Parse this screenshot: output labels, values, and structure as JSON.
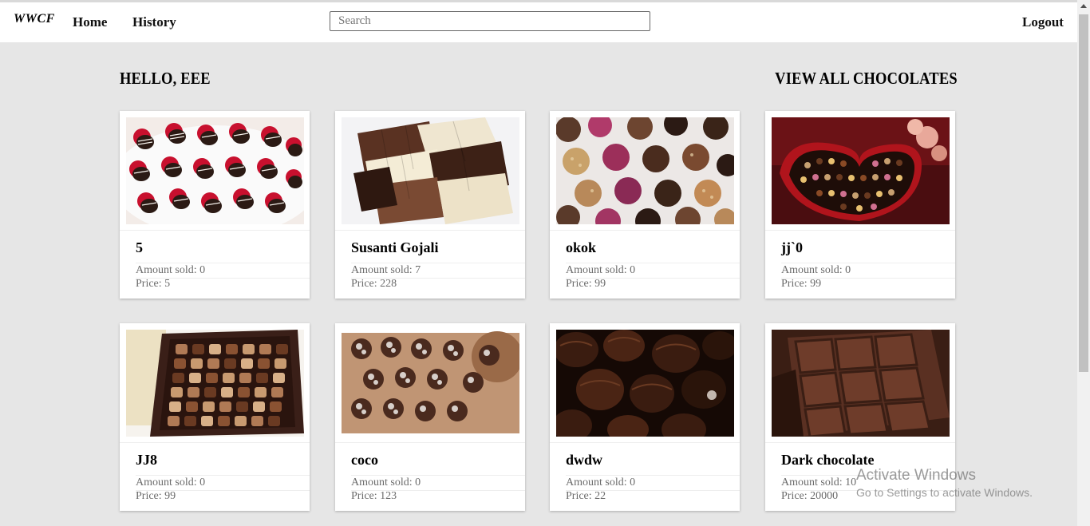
{
  "nav": {
    "brand": "WWCF",
    "home": "Home",
    "history": "History",
    "search_placeholder": "Search",
    "logout": "Logout"
  },
  "main": {
    "greeting": "HELLO, EEE",
    "view_all": "VIEW ALL CHOCOLATES"
  },
  "cards": [
    {
      "name": "5",
      "sold": "Amount sold: 0",
      "price": "Price: 5",
      "image": "chocolate-strawberries"
    },
    {
      "name": "Susanti Gojali",
      "sold": "Amount sold: 7",
      "price": "Price: 228",
      "image": "chocolate-bar-stack"
    },
    {
      "name": "okok",
      "sold": "Amount sold: 0",
      "price": "Price: 99",
      "image": "truffles-assorted"
    },
    {
      "name": "jj`0",
      "sold": "Amount sold: 0",
      "price": "Price: 99",
      "image": "heart-box-chocolates"
    },
    {
      "name": "JJ8",
      "sold": "Amount sold: 0",
      "price": "Price: 99",
      "image": "chocolate-box-grid"
    },
    {
      "name": "coco",
      "sold": "Amount sold: 0",
      "price": "Price: 123",
      "image": "crinkle-cookies"
    },
    {
      "name": "dwdw",
      "sold": "Amount sold: 0",
      "price": "Price: 22",
      "image": "dark-bonbons"
    },
    {
      "name": "Dark chocolate",
      "sold": "Amount sold: 10",
      "price": "Price: 20000",
      "image": "dark-chocolate-bar"
    }
  ],
  "watermark": {
    "line1": "Activate Windows",
    "line2": "Go to Settings to activate Windows."
  }
}
